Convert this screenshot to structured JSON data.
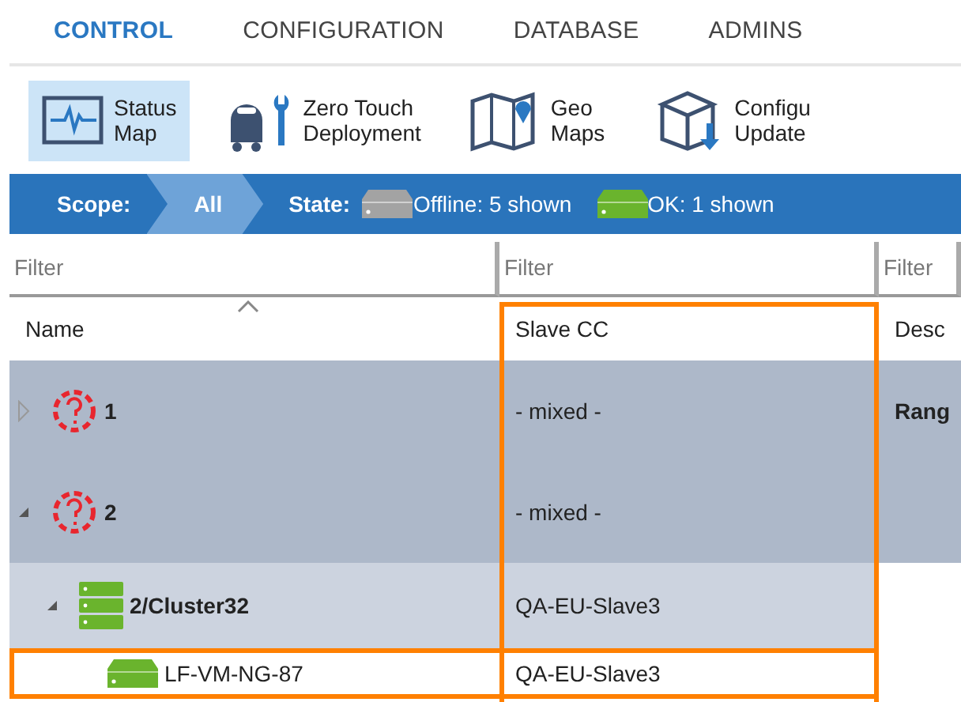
{
  "nav_tabs": [
    {
      "label": "CONTROL",
      "selected": true
    },
    {
      "label": "CONFIGURATION",
      "selected": false
    },
    {
      "label": "DATABASE",
      "selected": false
    },
    {
      "label": "ADMINS",
      "selected": false
    }
  ],
  "toolbar": [
    {
      "kind": "pulse",
      "lines": [
        "Status",
        "Map"
      ],
      "selected": true
    },
    {
      "kind": "robot",
      "lines": [
        "Zero Touch",
        "Deployment"
      ],
      "selected": false
    },
    {
      "kind": "map",
      "lines": [
        "Geo",
        "Maps"
      ],
      "selected": false
    },
    {
      "kind": "box",
      "lines": [
        "Configu",
        "Update"
      ],
      "selected": false
    }
  ],
  "scope_bar": {
    "scope_label": "Scope:",
    "scope_value": "All",
    "state_label": "State:",
    "states": [
      {
        "label": "Offline: 5 shown",
        "color": "#a3a3a3"
      },
      {
        "label": "OK: 1 shown",
        "color": "#6ab42d"
      }
    ]
  },
  "table": {
    "filters": [
      "Filter",
      "Filter",
      "Filter"
    ],
    "columns": [
      {
        "label": "Name",
        "sorted": true
      },
      {
        "label": "Slave CC",
        "highlighted": true
      },
      {
        "label": "Desc",
        "highlighted": false
      }
    ],
    "rows": [
      {
        "kind": "unknown",
        "name": "1",
        "expanded": false,
        "slave_cc": "- mixed -",
        "column_3": "Rang",
        "focused": false
      },
      {
        "kind": "unknown",
        "name": "2",
        "expanded": true,
        "slave_cc": "- mixed -",
        "focused": false,
        "children": [
          {
            "kind": "cluster",
            "name": "2/Cluster32",
            "expanded": true,
            "slave_cc": "QA-EU-Slave3",
            "focused": false,
            "children": [
              {
                "kind": "server",
                "name": "LF-VM-NG-87",
                "slave_cc": "QA-EU-Slave3",
                "focused": true
              }
            ]
          }
        ]
      }
    ]
  }
}
